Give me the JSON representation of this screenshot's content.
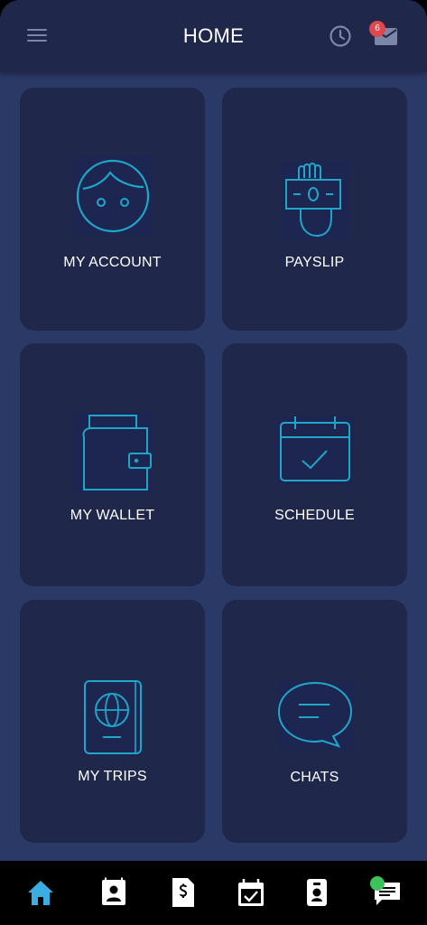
{
  "header": {
    "title": "HOME",
    "menu_icon": "hamburger-menu-icon",
    "history_icon": "clock-icon",
    "inbox_icon": "mail-icon",
    "notification_count": "6"
  },
  "tiles": [
    {
      "label": "MY ACCOUNT",
      "icon": "user-face-icon"
    },
    {
      "label": "PAYSLIP",
      "icon": "hand-holding-cash-icon"
    },
    {
      "label": "MY WALLET",
      "icon": "wallet-icon"
    },
    {
      "label": "SCHEDULE",
      "icon": "calendar-check-icon"
    },
    {
      "label": "MY TRIPS",
      "icon": "passport-icon"
    },
    {
      "label": "CHATS",
      "icon": "speech-bubble-icon"
    }
  ],
  "bottom_nav": [
    {
      "icon": "home-icon",
      "active": true
    },
    {
      "icon": "contact-card-icon",
      "active": false
    },
    {
      "icon": "dollar-document-icon",
      "active": false
    },
    {
      "icon": "calendar-check-icon",
      "active": false
    },
    {
      "icon": "badge-icon",
      "active": false
    },
    {
      "icon": "chat-icon",
      "active": false
    }
  ],
  "colors": {
    "background": "#2b3966",
    "card": "#1f274a",
    "accent": "#1fa6c9",
    "active_nav": "#3aaee0",
    "badge": "#e0474c",
    "online": "#3cc35c"
  }
}
